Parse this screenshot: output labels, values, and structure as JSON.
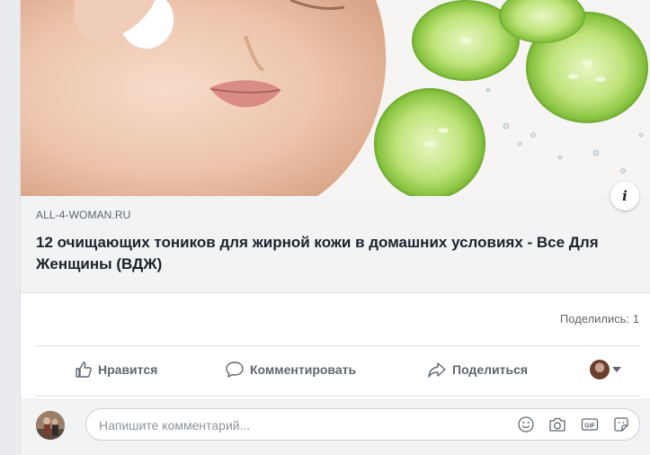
{
  "post": {
    "image_alt": "woman cleansing face with cotton pad, cucumber slices",
    "link_domain": "ALL-4-WOMAN.RU",
    "link_title": "12 очищающих тоников для жирной кожи в домашних условиях - Все Для Женщины (ВДЖ)",
    "info_label": "i",
    "shares_text": "Поделились: 1"
  },
  "actions": {
    "like": "Нравится",
    "comment": "Комментировать",
    "share": "Поделиться"
  },
  "comment": {
    "placeholder": "Напишите комментарий...",
    "icons": [
      "emoji-icon",
      "camera-icon",
      "gif-icon",
      "sticker-icon"
    ]
  },
  "colors": {
    "page_bg": "#e9ebee",
    "meta_bg": "#f2f3f5",
    "action_text": "#606770",
    "title_text": "#1d2129",
    "cucumber_green": "#7cc242"
  }
}
